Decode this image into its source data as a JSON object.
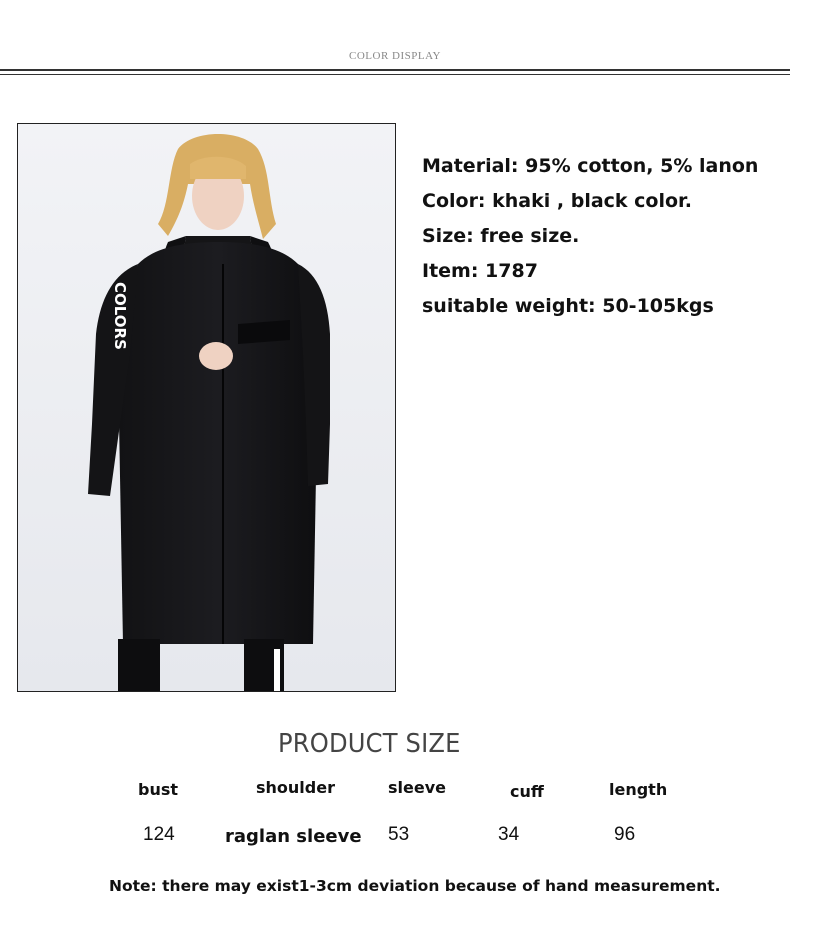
{
  "header": {
    "title": "COLOR DISPLAY"
  },
  "specs": [
    "Material: 95% cotton, 5% lanon",
    "Color: khaki , black color.",
    "Size: free size.",
    "Item: 1787",
    "suitable weight: 50-105kgs"
  ],
  "size_section": {
    "title": "PRODUCT SIZE",
    "headers": {
      "bust": "bust",
      "shoulder": "shoulder",
      "sleeve": "sleeve",
      "cuff": "cuff",
      "length": "length"
    },
    "values": {
      "bust": "124",
      "shoulder": "raglan sleeve",
      "sleeve": "53",
      "cuff": "34",
      "length": "96"
    }
  },
  "sleeve_print": "COLORS",
  "note": "Note: there may exist1-3cm deviation because of hand measurement."
}
